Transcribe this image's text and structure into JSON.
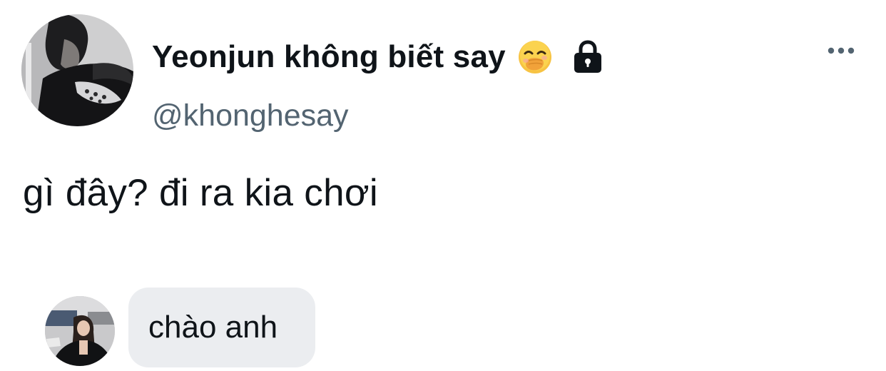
{
  "tweet": {
    "display_name": "Yeonjun không biết say",
    "handle": "@khonghesay",
    "text": "gì đây? đi ra kia chơi",
    "icons": {
      "name_emoji": "face-with-hand-over-mouth-icon",
      "protected": "lock-icon",
      "more": "more-options-icon"
    }
  },
  "reply": {
    "text": "chào anh"
  },
  "colors": {
    "text_primary": "#0f1419",
    "text_secondary": "#536471",
    "bubble_bg": "#ebedf0",
    "background": "#ffffff"
  }
}
